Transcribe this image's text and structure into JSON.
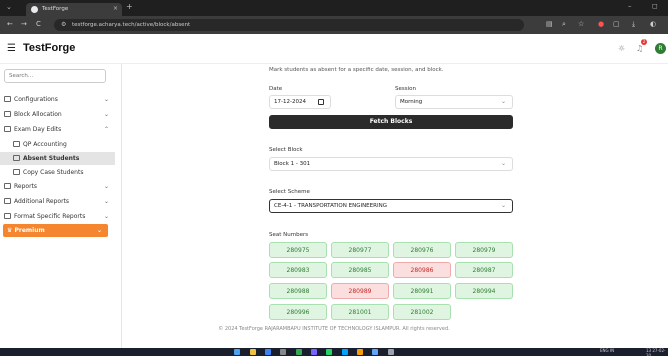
{
  "browser": {
    "tab_title": "TestForge",
    "url": "testforge.acharya.tech/active/block/absent",
    "new_tab": "+",
    "close_tab": "×",
    "minimize": "–",
    "restore": "◻",
    "nav_back": "←",
    "nav_forward": "→",
    "reload": "C"
  },
  "header": {
    "brand": "TestForge",
    "menu_icon": "☰",
    "notification_count": "2",
    "avatar_initial": "R"
  },
  "sidebar": {
    "search_placeholder": "Search...",
    "items": [
      {
        "label": "Configurations",
        "caret": "⌄"
      },
      {
        "label": "Block Allocation",
        "caret": "⌄"
      },
      {
        "label": "Exam Day Edits",
        "caret": "⌃"
      },
      {
        "label": "QP Accounting"
      },
      {
        "label": "Absent Students"
      },
      {
        "label": "Copy Case Students"
      },
      {
        "label": "Reports",
        "caret": "⌄"
      },
      {
        "label": "Additional Reports",
        "caret": "⌄"
      },
      {
        "label": "Format Specific Reports",
        "caret": "⌄"
      },
      {
        "label": "Premium",
        "caret": "⌄"
      }
    ]
  },
  "form": {
    "subtitle": "Mark students as absent for a specific date, session, and block.",
    "date_label": "Date",
    "date_value": "17-12-2024",
    "session_label": "Session",
    "session_value": "Morning",
    "fetch_label": "Fetch Blocks",
    "block_label": "Select Block",
    "block_value": "Block 1 - 301",
    "scheme_label": "Select Scheme",
    "scheme_value": "CE-4-1 - TRANSPORTATION ENGINEERING",
    "seat_label": "Seat Numbers",
    "dropdown_caret": "⌄"
  },
  "seats": [
    {
      "num": "280975",
      "absent": false
    },
    {
      "num": "280977",
      "absent": false
    },
    {
      "num": "280976",
      "absent": false
    },
    {
      "num": "280979",
      "absent": false
    },
    {
      "num": "280983",
      "absent": false
    },
    {
      "num": "280985",
      "absent": false
    },
    {
      "num": "280986",
      "absent": true
    },
    {
      "num": "280987",
      "absent": false
    },
    {
      "num": "280988",
      "absent": false
    },
    {
      "num": "280989",
      "absent": true
    },
    {
      "num": "280991",
      "absent": false
    },
    {
      "num": "280994",
      "absent": false
    },
    {
      "num": "280996",
      "absent": false
    },
    {
      "num": "281001",
      "absent": false
    },
    {
      "num": "281002",
      "absent": false
    }
  ],
  "footer": "© 2024 TestForge RAJARAMBAPU INSTITUTE OF TECHNOLOGY ISLAMPUR. All rights reserved.",
  "taskbar": {
    "lang": "ENG",
    "region": "IN",
    "time": "13",
    "date": "27-02-20"
  },
  "colors": {
    "present_bg": "#dff5e1",
    "absent_bg": "#fbdede",
    "premium": "#f5862f",
    "fetch_button": "#2b2b2b"
  }
}
